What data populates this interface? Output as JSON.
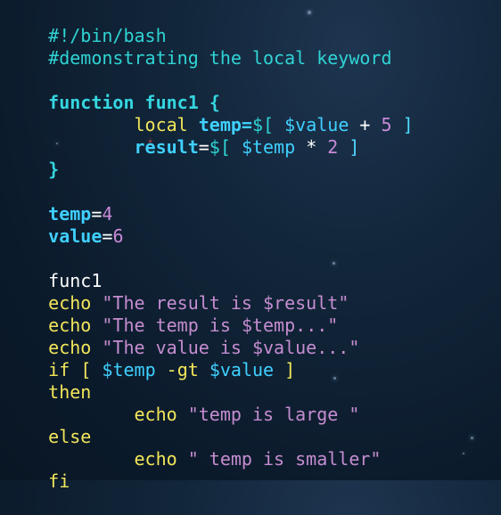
{
  "editor": {
    "line1": "#!/bin/bash",
    "line2": "#demonstrating the local keyword",
    "line4_kw": "function",
    "line4_name": "func1",
    "line4_brace": "{",
    "line5_local": "local",
    "line5_assign": "temp=",
    "line5_expr_a": "$[",
    "line5_expr_b": "$value",
    "line5_expr_c": "+",
    "line5_expr_d": "5",
    "line5_expr_e": "]",
    "line6_var": "result",
    "line6_eq": "=",
    "line6_expr_a": "$[",
    "line6_expr_b": "$temp",
    "line6_expr_c": "*",
    "line6_expr_d": "2",
    "line6_expr_e": "]",
    "line7": "}",
    "line9_var": "temp",
    "line9_eq": "=",
    "line9_val": "4",
    "line10_var": "value",
    "line10_eq": "=",
    "line10_val": "6",
    "line12": "func1",
    "line13_cmd": "echo",
    "line13_str_a": "\"The result is ",
    "line13_str_var": "$result",
    "line13_str_b": "\"",
    "line14_cmd": "echo",
    "line14_str_a": "\"The temp is ",
    "line14_str_var": "$temp",
    "line14_str_b": "...\"",
    "line15_cmd": "echo",
    "line15_str_a": "\"The value is ",
    "line15_str_var": "$value",
    "line15_str_b": "...\"",
    "line16_if": "if",
    "line16_lb": "[",
    "line16_var1": "$temp",
    "line16_op": "-gt",
    "line16_var2": "$value",
    "line16_rb": "]",
    "line17": "then",
    "line18_cmd": "echo",
    "line18_str": "\"temp is large \"",
    "line19": "else",
    "line20_cmd": "echo",
    "line20_str": "\" temp is smaller\"",
    "line21": "fi"
  }
}
